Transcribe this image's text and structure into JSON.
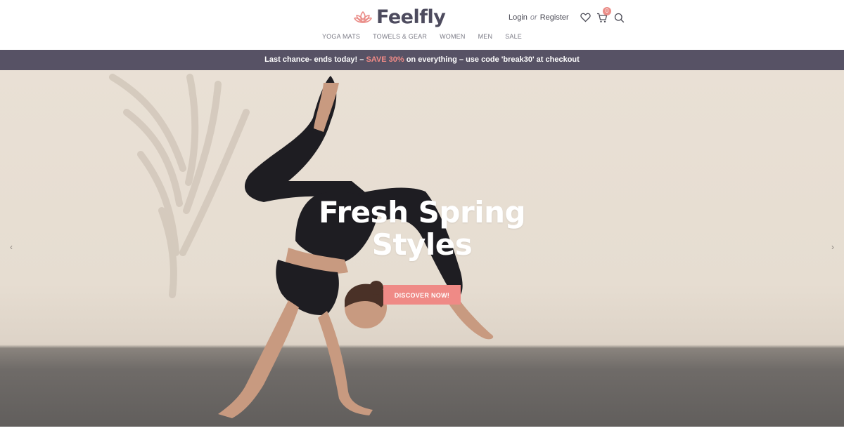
{
  "brand": {
    "name": "Feelfly",
    "logo_icon": "lotus-icon",
    "accent": "#ef8a86"
  },
  "account": {
    "login": "Login",
    "or": "or",
    "register": "Register"
  },
  "icons": {
    "wishlist": "heart-icon",
    "cart": "cart-icon",
    "search": "search-icon"
  },
  "cart": {
    "count": "0"
  },
  "nav": [
    {
      "label": "YOGA MATS"
    },
    {
      "label": "TOWELS & GEAR"
    },
    {
      "label": "WOMEN"
    },
    {
      "label": "MEN"
    },
    {
      "label": "SALE"
    }
  ],
  "promo": {
    "before": "Last chance- ends today! – ",
    "highlight": "SAVE 30%",
    "after": " on everything – use code 'break30' at checkout",
    "background": "#575265"
  },
  "hero": {
    "title_line1": "Fresh Spring",
    "title_line2": "Styles",
    "cta": "DISCOVER NOW!",
    "prev_icon": "chevron-left-icon",
    "next_icon": "chevron-right-icon",
    "prev_glyph": "‹",
    "next_glyph": "›"
  }
}
